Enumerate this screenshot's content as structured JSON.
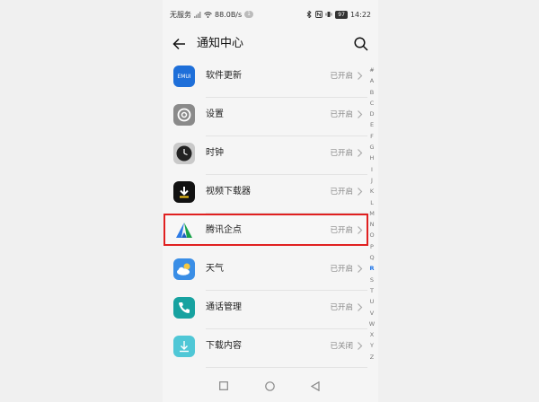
{
  "status_bar": {
    "carrier": "无服务",
    "speed": "88.0B/s",
    "badge": "1",
    "battery": "97",
    "time": "14:22"
  },
  "header": {
    "title": "通知中心"
  },
  "apps": [
    {
      "name": "软件更新",
      "status": "已开启",
      "icon": "emui-icon",
      "color": "#1e6fd9"
    },
    {
      "name": "设置",
      "status": "已开启",
      "icon": "settings-icon",
      "color": "#8a8a8a"
    },
    {
      "name": "时钟",
      "status": "已开启",
      "icon": "clock-icon",
      "color": "#9a9a9a"
    },
    {
      "name": "视频下载器",
      "status": "已开启",
      "icon": "download-icon",
      "color": "#111111"
    },
    {
      "name": "腾讯企点",
      "status": "已开启",
      "icon": "tencent-qidian-icon",
      "color": "#ffffff"
    },
    {
      "name": "天气",
      "status": "已开启",
      "icon": "weather-icon",
      "color": "#3a8ee6"
    },
    {
      "name": "通话管理",
      "status": "已开启",
      "icon": "phone-icon",
      "color": "#17a2a0"
    },
    {
      "name": "下载内容",
      "status": "已关闭",
      "icon": "download-content-icon",
      "color": "#4fc7d6"
    }
  ],
  "emui_text": "EMUI",
  "alphabet": [
    "#",
    "A",
    "B",
    "C",
    "D",
    "E",
    "F",
    "G",
    "H",
    "I",
    "J",
    "K",
    "L",
    "M",
    "N",
    "O",
    "P",
    "Q",
    "R",
    "S",
    "T",
    "U",
    "V",
    "W",
    "X",
    "Y",
    "Z"
  ],
  "alphabet_active": "R",
  "highlight_color": "#e02020"
}
